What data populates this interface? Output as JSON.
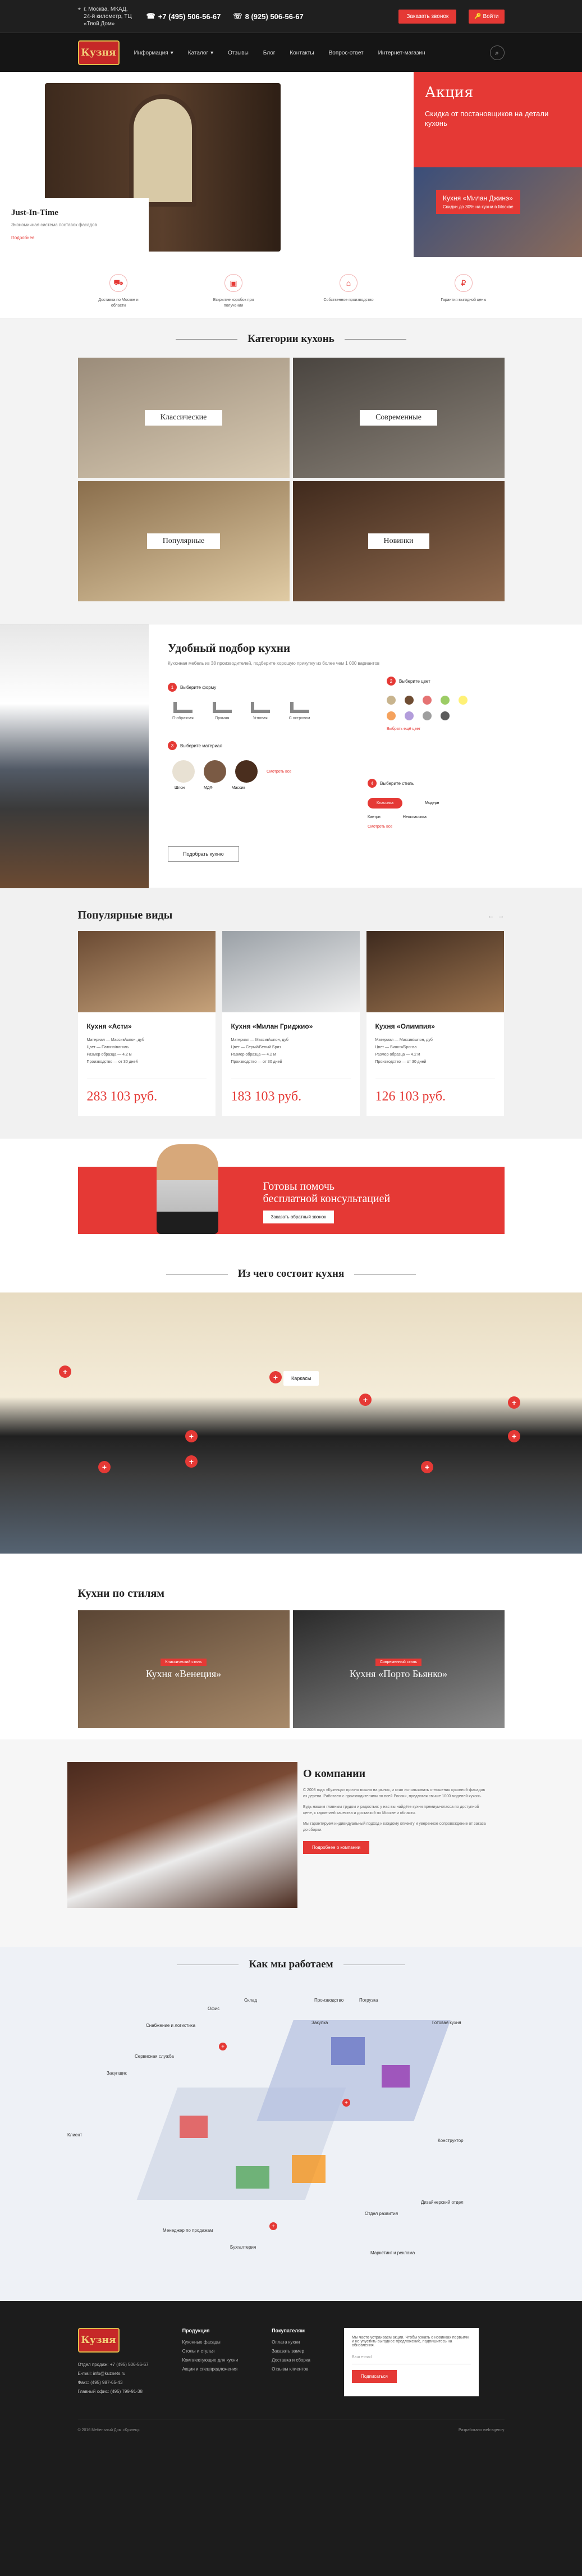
{
  "topbar": {
    "address": "г. Москва, МКАД, 24-й километр, ТЦ «Твой Дом»",
    "phone1": "+7 (495) 506-56-67",
    "phone2": "8 (925) 506-56-67",
    "callback": "Заказать звонок",
    "cart": "Войти"
  },
  "nav": {
    "logo": "Кузня",
    "items": [
      "Информация",
      "Каталог",
      "Отзывы",
      "Блог",
      "Контакты",
      "Вопрос-ответ",
      "Интернет-магазин"
    ]
  },
  "hero": {
    "card_title": "Just-In-Time",
    "card_text": "Экономичная система поставок фасадов",
    "card_link": "Подробнее",
    "promo_title": "Акция",
    "promo_text": "Скидка от постановщиков на детали кухонь",
    "promo_tile_title": "Кухня «Милан Джинэ»",
    "promo_tile_sub": "Cкидки до 30% на кухни в Москве"
  },
  "features": [
    {
      "icon": "truck-icon",
      "text": "Доставка по Москве и области"
    },
    {
      "icon": "box-icon",
      "text": "Вскрытие коробок при получении"
    },
    {
      "icon": "factory-icon",
      "text": "Собственное производство"
    },
    {
      "icon": "ruble-icon",
      "text": "Гарантия выгодной цены"
    }
  ],
  "categories": {
    "title": "Категории кухонь",
    "items": [
      "Классические",
      "Современные",
      "Популярные",
      "Новинки"
    ]
  },
  "selector": {
    "title": "Удобный подбор кухни",
    "subtitle": "Кухонная мебель из 38 производителей, подберите хорошую прикупку из более чем 1 000 вариантов",
    "step1": "Выберите форму",
    "step2": "Выберите цвет",
    "step3": "Выберите материал",
    "step4": "Выберите стиль",
    "shapes": [
      "П-образная",
      "Прямая",
      "Угловая",
      "С островом"
    ],
    "colors": [
      "#c8b48e",
      "#6f4d33",
      "#e57373",
      "#9ccc65",
      "#fff176",
      "#f5a25d",
      "#b39ddb",
      "#9e9e9e",
      "#5d5d5d"
    ],
    "color_more": "Выбрать ещё цвет",
    "materials": [
      "Шпон",
      "МДФ",
      "Массив"
    ],
    "material_more": "Смотреть все",
    "styles": [
      "Классика",
      "Модерн",
      "Кантри",
      "Неоклассика"
    ],
    "style_more": "Смотреть все",
    "button": "Подобрать кухню"
  },
  "popular": {
    "title": "Популярные виды",
    "cards": [
      {
        "name": "Кухня «Асти»",
        "material": "Материал — Массив/шпон, дуб",
        "color": "Цвет — Патина/ваниль",
        "size": "Размер образца — 4.2 м",
        "mfr": "Производство — от 30 дней",
        "price": "283 103 руб."
      },
      {
        "name": "Кухня «Милан Гриджио»",
        "material": "Материал — Массив/шпон, дуб",
        "color": "Цвет — Серый/Белый Бриз",
        "size": "Размер образца — 4.2 м",
        "mfr": "Производство — от 30 дней",
        "price": "183 103 руб."
      },
      {
        "name": "Кухня «Олимпия»",
        "material": "Материал — Массив/шпон, дуб",
        "color": "Цвет — Вишня/Бронза",
        "size": "Размер образца — 4.2 м",
        "mfr": "Производство — от 30 дней",
        "price": "126 103 руб."
      }
    ]
  },
  "consult": {
    "text1": "Готовы помочь",
    "text2": "бесплатной консультацией",
    "button": "Заказать обратный звонок"
  },
  "compose": {
    "title": "Из чего состоит кухня",
    "popup": "Каркасы"
  },
  "styles": {
    "title": "Кухни по стилям",
    "items": [
      {
        "tag": "Классический стиль",
        "name": "Кухня «Венеция»"
      },
      {
        "tag": "Современный стиль",
        "name": "Кухня «Порто Бьянко»"
      }
    ]
  },
  "about": {
    "title": "О компании",
    "p1": "С 2008 года «Кузница» прочно вошла на рынок, и стал использовать отношения кухонной фасадов из дерева. Работаем с производителями по всей России, предлагая свыше 1000 моделей кухонь.",
    "p2": "Будь нашим главным трудом и радостью: у нас вы найдёте кухни премиум-класса по доступной цене, с гарантией качества и доставкой по Москве и области.",
    "p3": "Мы гарантируем индивидуальный подход к каждому клиенту и уверенное сопровождение от заказа до сборки.",
    "button": "Подробнее о компании"
  },
  "how": {
    "title": "Как мы работаем",
    "labels": [
      "Склад",
      "Офис",
      "Производство",
      "Погрузка",
      "Готовая кухня",
      "Снабжение и логистика",
      "Закупщик",
      "Сервисная служба",
      "Закупка",
      "Клиент",
      "Конструктор",
      "Менеджер по продажам",
      "Бухгалтерия",
      "Отдел развития",
      "Дизайнерский отдел",
      "Маркетинг и реклама"
    ]
  },
  "footer": {
    "address_label": "Отдел продаж:",
    "phone": "+7 (495) 506-56-67",
    "email": "info@kuznets.ru",
    "fax": "(495) 987-65-43",
    "office": "(495) 799-91-38",
    "col1_title": "Продукция",
    "col1": [
      "Кухонные фасады",
      "Столы и стулья",
      "Комплектующие для кухни",
      "Акции и спецпредложения"
    ],
    "col2_title": "Покупателям",
    "col2": [
      "Оплата кухни",
      "Заказать замер",
      "Доставка и сборка",
      "Отзывы клиентов"
    ],
    "subscribe_text": "Мы часто устраиваем акции. Чтобы узнать о новинках первыми и не упустить выгодное предложение, подпишитесь на обновления.",
    "subscribe_placeholder": "Ваш e-mail",
    "subscribe_btn": "Подписаться",
    "copyright": "© 2016 Мебельный Дом «Кузнец»",
    "dev": "Разработано web-agency"
  }
}
